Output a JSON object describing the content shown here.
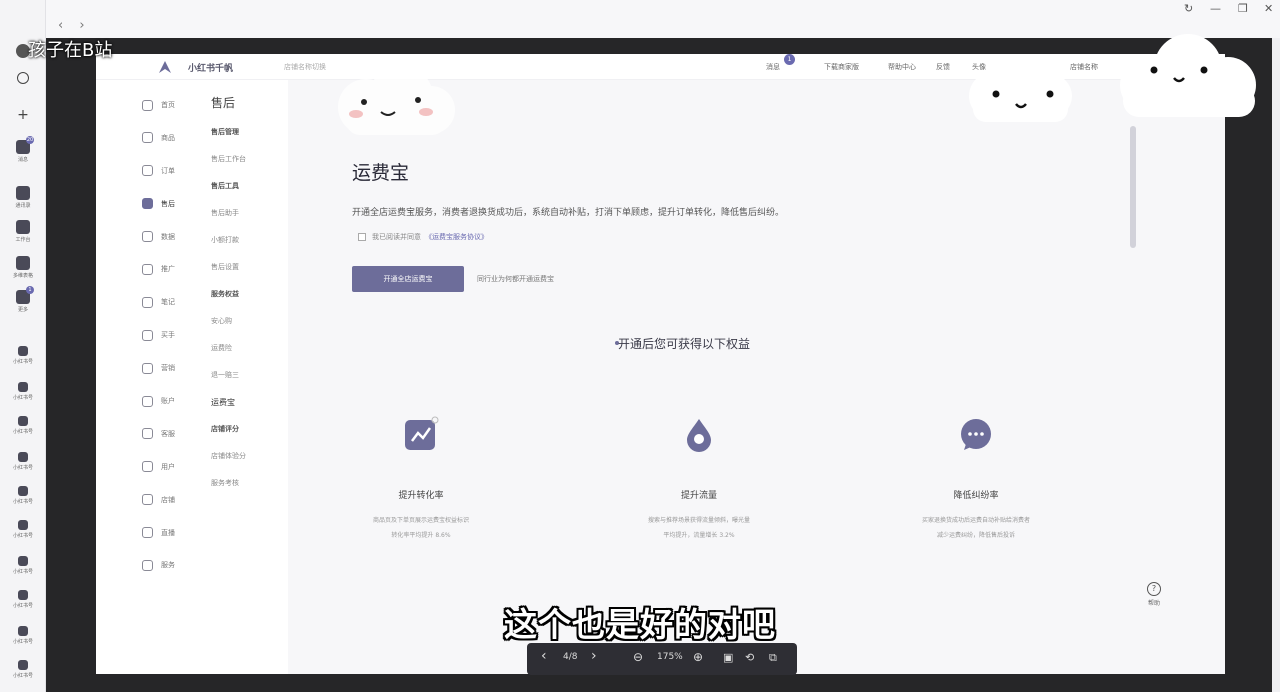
{
  "outer_window": {
    "controls": {
      "history_icon": "↻",
      "minimize": "—",
      "maximize": "❐",
      "close": "✕"
    },
    "nav": {
      "back": "‹",
      "forward": "›"
    }
  },
  "left_rail": {
    "items": [
      {
        "label": "",
        "badge": ""
      },
      {
        "label": "",
        "badge": ""
      },
      {
        "label": "",
        "badge": ""
      },
      {
        "label": "消息",
        "badge": "20"
      },
      {
        "label": "通讯录",
        "badge": ""
      },
      {
        "label": "工作台",
        "badge": ""
      },
      {
        "label": "多维表格",
        "badge": ""
      },
      {
        "label": "更多",
        "badge": "1"
      },
      {
        "label": "小红书号",
        "badge": ""
      },
      {
        "label": "小红书号",
        "badge": ""
      },
      {
        "label": "小红书号",
        "badge": ""
      },
      {
        "label": "小红书号",
        "badge": ""
      },
      {
        "label": "小红书号",
        "badge": ""
      },
      {
        "label": "小红书号",
        "badge": ""
      },
      {
        "label": "小红书号",
        "badge": ""
      },
      {
        "label": "小红书号",
        "badge": ""
      },
      {
        "label": "小红书号",
        "badge": ""
      },
      {
        "label": "小红书号",
        "badge": ""
      }
    ]
  },
  "page": {
    "brand": "小红书千帆",
    "store_switch": "店铺名称切换",
    "top_links": [
      {
        "label": "消息",
        "badge": "1"
      },
      {
        "label": "下载商家版"
      },
      {
        "label": "帮助中心"
      },
      {
        "label": "反馈"
      },
      {
        "label": "头像"
      },
      {
        "label": "店铺名称"
      }
    ],
    "main_nav": [
      "首页",
      "商品",
      "订单",
      "售后",
      "数据",
      "推广",
      "笔记",
      "买手",
      "营销",
      "账户",
      "客服",
      "用户",
      "店铺",
      "直播",
      "服务"
    ],
    "sub_nav": {
      "title": "售后",
      "items": [
        {
          "label": "售后管理",
          "type": "group"
        },
        {
          "label": "售后工作台",
          "type": "item"
        },
        {
          "label": "售后工具",
          "type": "group"
        },
        {
          "label": "售后助手",
          "type": "item"
        },
        {
          "label": "小额打款",
          "type": "item"
        },
        {
          "label": "售后设置",
          "type": "item"
        },
        {
          "label": "服务权益",
          "type": "group"
        },
        {
          "label": "安心购",
          "type": "item"
        },
        {
          "label": "运费险",
          "type": "item"
        },
        {
          "label": "退一赔三",
          "type": "item"
        },
        {
          "label": "运费宝",
          "type": "active"
        },
        {
          "label": "店铺评分",
          "type": "group"
        },
        {
          "label": "店铺体验分",
          "type": "item"
        },
        {
          "label": "服务考核",
          "type": "item"
        }
      ]
    },
    "content": {
      "title": "运费宝",
      "description": "开通全店运费宝服务，消费者退换货成功后，系统自动补贴，打消下单顾虑，提升订单转化，降低售后纠纷。",
      "agree_text": "我已阅读并同意",
      "agree_link": "《运费宝服务协议》",
      "open_button": "开通全店运费宝",
      "help_link": "同行业为何都开通运费宝",
      "benefits_title": "开通后您可获得以下权益",
      "benefits": [
        {
          "icon": "chart-icon",
          "title": "提升转化率",
          "desc_line1": "商品页及下单页展示运费宝权益标识",
          "desc_line2": "转化率平均提升 8.6%"
        },
        {
          "icon": "drop-icon",
          "title": "提升流量",
          "desc_line1": "搜索与推荐场景获得流量倾斜，曝光量",
          "desc_line2": "平均提升，流量增长 3.2%"
        },
        {
          "icon": "chat-icon",
          "title": "降低纠纷率",
          "desc_line1": "买家退换货成功后运费自动补贴给消费者",
          "desc_line2": "减少运费纠纷，降低售后投诉"
        }
      ]
    },
    "help_float": "帮助",
    "accent": "#6d6d9a"
  },
  "overlay": {
    "watermark": "孩子在B站",
    "subtitle": "这个也是好的对吧"
  },
  "pdf_toolbar": {
    "prev": "‹",
    "page": "4/8",
    "next": "›",
    "zoom_out": "⊖",
    "zoom": "175%",
    "zoom_in": "⊕",
    "fit": "▣",
    "rotate": "⟲",
    "copy": "⧉"
  }
}
